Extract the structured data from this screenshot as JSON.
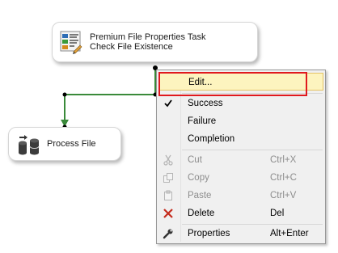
{
  "canvas": {
    "task": {
      "title": "Premium File Properties Task",
      "subtitle": "Check File Existence"
    },
    "process": {
      "label": "Process File"
    },
    "connector_color": "#3a8a3a"
  },
  "context_menu": {
    "items": [
      {
        "label": "Edit...",
        "shortcut": "",
        "icon": "none",
        "state": "highlighted"
      },
      {
        "label": "Success",
        "shortcut": "",
        "icon": "checkmark-icon",
        "state": "checked"
      },
      {
        "label": "Failure",
        "shortcut": "",
        "icon": "none",
        "state": "normal"
      },
      {
        "label": "Completion",
        "shortcut": "",
        "icon": "none",
        "state": "normal"
      },
      {
        "label": "Cut",
        "shortcut": "Ctrl+X",
        "icon": "scissors-icon",
        "state": "disabled"
      },
      {
        "label": "Copy",
        "shortcut": "Ctrl+C",
        "icon": "copy-icon",
        "state": "disabled"
      },
      {
        "label": "Paste",
        "shortcut": "Ctrl+V",
        "icon": "paste-icon",
        "state": "disabled"
      },
      {
        "label": "Delete",
        "shortcut": "Del",
        "icon": "delete-x-icon",
        "state": "normal"
      },
      {
        "label": "Properties",
        "shortcut": "Alt+Enter",
        "icon": "wrench-icon",
        "state": "normal"
      }
    ],
    "highlight_color": "#fdf4bf",
    "focus_outline_color": "#e0191e"
  }
}
